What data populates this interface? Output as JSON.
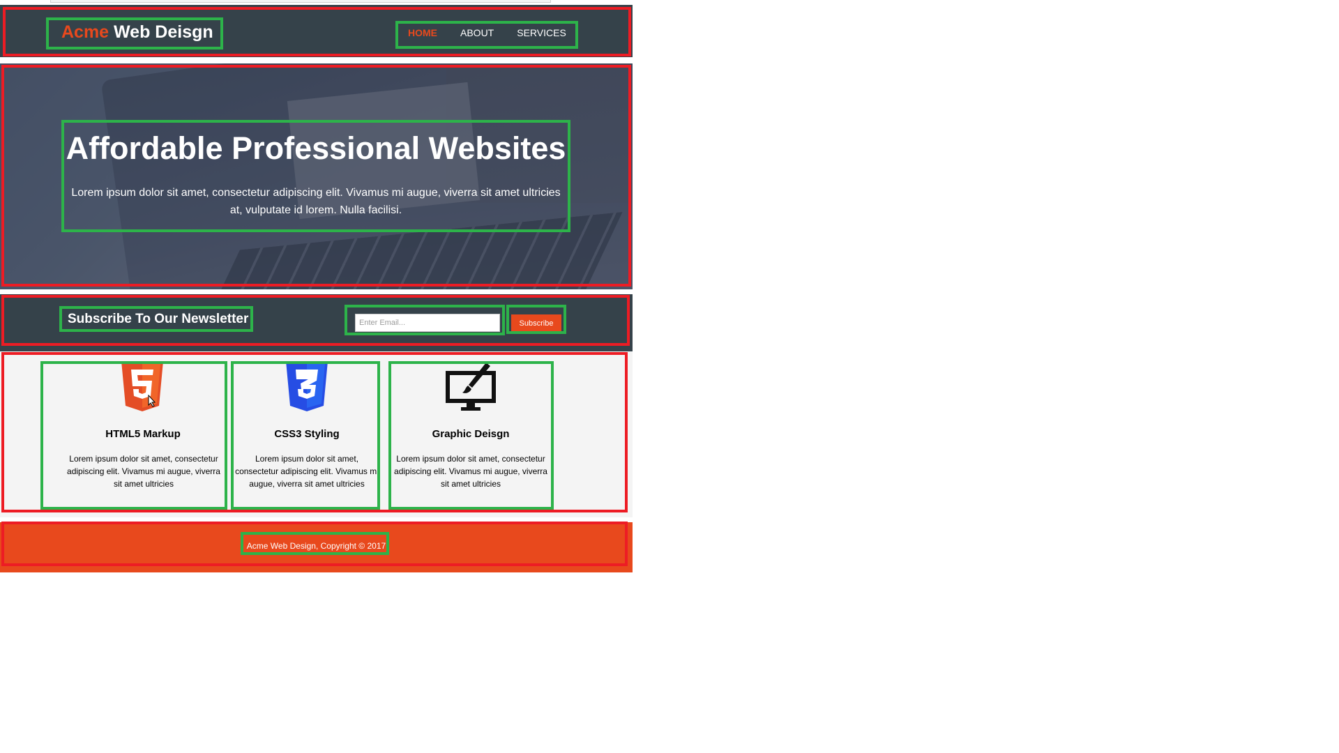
{
  "header": {
    "logo_highlight": "Acme",
    "logo_rest": " Web Deisgn",
    "nav": [
      {
        "label": "HOME",
        "active": true
      },
      {
        "label": "ABOUT",
        "active": false
      },
      {
        "label": "SERVICES",
        "active": false
      }
    ]
  },
  "hero": {
    "title": "Affordable Professional Websites",
    "body": "Lorem ipsum dolor sit amet, consectetur adipiscing elit. Vivamus mi augue, viverra sit amet ultricies at, vulputate id lorem. Nulla facilisi."
  },
  "newsletter": {
    "title": "Subscribe To Our Newsletter",
    "email_placeholder": "Enter Email...",
    "button_label": "Subscribe"
  },
  "boxes": [
    {
      "icon": "html5-icon",
      "title": "HTML5 Markup",
      "text": "Lorem ipsum dolor sit amet, consectetur adipiscing elit. Vivamus mi augue, viverra sit amet ultricies"
    },
    {
      "icon": "css3-icon",
      "title": "CSS3 Styling",
      "text": "Lorem ipsum dolor sit amet, consectetur adipiscing elit. Vivamus mi augue, viverra sit amet ultricies"
    },
    {
      "icon": "monitor-brush-icon",
      "title": "Graphic Deisgn",
      "text": "Lorem ipsum dolor sit amet, consectetur adipiscing elit. Vivamus mi augue, viverra sit amet ultricies"
    }
  ],
  "footer": {
    "text": "Acme Web Design, Copyright © 2017"
  },
  "colors": {
    "dark": "#35424a",
    "accent": "#e8491d",
    "outline_red": "#ed1c24",
    "outline_green": "#2db34a"
  }
}
